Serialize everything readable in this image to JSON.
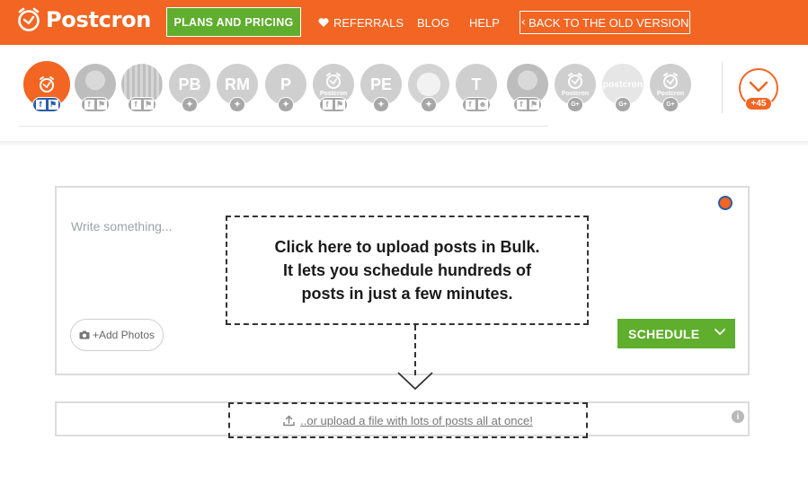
{
  "nav": {
    "logo": "Postcron",
    "plans": "PLANS AND PRICING",
    "referrals": "REFERRALS",
    "blog": "BLOG",
    "help": "HELP",
    "back": "BACK TO THE OLD VERSION"
  },
  "accounts": [
    {
      "initials": "",
      "badge": "f-flag",
      "selected": true
    },
    {
      "initials": "",
      "badge": "f-flag"
    },
    {
      "initials": "",
      "badge": "f-flag"
    },
    {
      "initials": "PB",
      "badge": "twitter"
    },
    {
      "initials": "RM",
      "badge": "twitter"
    },
    {
      "initials": "P",
      "badge": "twitter"
    },
    {
      "initials": "",
      "label": "Postcron",
      "badge": "f-flag"
    },
    {
      "initials": "PE",
      "badge": "twitter"
    },
    {
      "initials": "",
      "badge": "twitter"
    },
    {
      "initials": "T",
      "badge": "f-group"
    },
    {
      "initials": "",
      "badge": "f-flag"
    },
    {
      "initials": "",
      "label": "Postcron",
      "badge": "google-plus"
    },
    {
      "initials": "postcron",
      "badge": "google-plus"
    },
    {
      "initials": "",
      "label": "Postcron",
      "badge": "google-plus"
    }
  ],
  "more_accounts": "+45",
  "composer": {
    "placeholder": "Write something...",
    "add_photos": "+Add Photos",
    "schedule": "SCHEDULE"
  },
  "callout": {
    "line1": "Click here to upload posts in Bulk.",
    "line2": "It lets you schedule hundreds of",
    "line3": "posts in just a few minutes."
  },
  "bulk": {
    "link": "..or upload a file with lots of posts all at once!"
  },
  "colors": {
    "brand_orange": "#f26522",
    "accent_green": "#5fae2d",
    "facebook_blue": "#2a5da8"
  }
}
